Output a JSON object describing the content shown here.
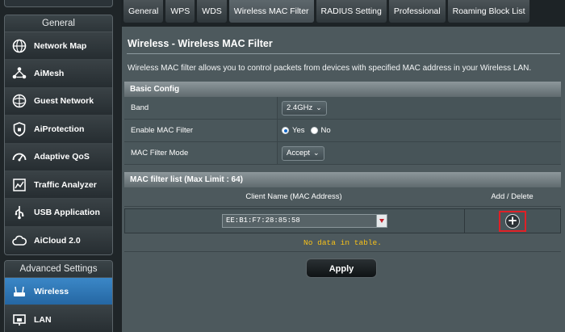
{
  "sidebar": {
    "general_header": "General",
    "items": [
      {
        "label": "Network Map",
        "icon": "network-map-icon"
      },
      {
        "label": "AiMesh",
        "icon": "aimesh-icon"
      },
      {
        "label": "Guest Network",
        "icon": "guest-network-icon"
      },
      {
        "label": "AiProtection",
        "icon": "aiprotection-icon"
      },
      {
        "label": "Adaptive QoS",
        "icon": "adaptive-qos-icon"
      },
      {
        "label": "Traffic Analyzer",
        "icon": "traffic-analyzer-icon"
      },
      {
        "label": "USB Application",
        "icon": "usb-application-icon"
      },
      {
        "label": "AiCloud 2.0",
        "icon": "aicloud-icon"
      }
    ],
    "advanced_header": "Advanced Settings",
    "advanced_items": [
      {
        "label": "Wireless",
        "icon": "wireless-icon",
        "active": true
      },
      {
        "label": "LAN",
        "icon": "lan-icon"
      }
    ]
  },
  "tabs": [
    {
      "label": "General"
    },
    {
      "label": "WPS"
    },
    {
      "label": "WDS"
    },
    {
      "label": "Wireless MAC Filter",
      "active": true
    },
    {
      "label": "RADIUS Setting"
    },
    {
      "label": "Professional"
    },
    {
      "label": "Roaming Block List"
    }
  ],
  "page": {
    "title": "Wireless - Wireless MAC Filter",
    "description": "Wireless MAC filter allows you to control packets from devices with specified MAC address in your Wireless LAN."
  },
  "basic_config": {
    "header": "Basic Config",
    "band_label": "Band",
    "band_value": "2.4GHz",
    "enable_label": "Enable MAC Filter",
    "enable_yes": "Yes",
    "enable_no": "No",
    "enable_selected": "Yes",
    "mode_label": "MAC Filter Mode",
    "mode_value": "Accept"
  },
  "mac_list": {
    "header": "MAC filter list (Max Limit : 64)",
    "col_client": "Client Name (MAC Address)",
    "col_add": "Add / Delete",
    "input_value": "EE:B1:F7:28:85:58",
    "no_data": "No data in table."
  },
  "apply_label": "Apply",
  "colors": {
    "active_blue": "#2f78b8",
    "highlight_red": "#e02026",
    "no_data_yellow": "#f6c01a"
  }
}
